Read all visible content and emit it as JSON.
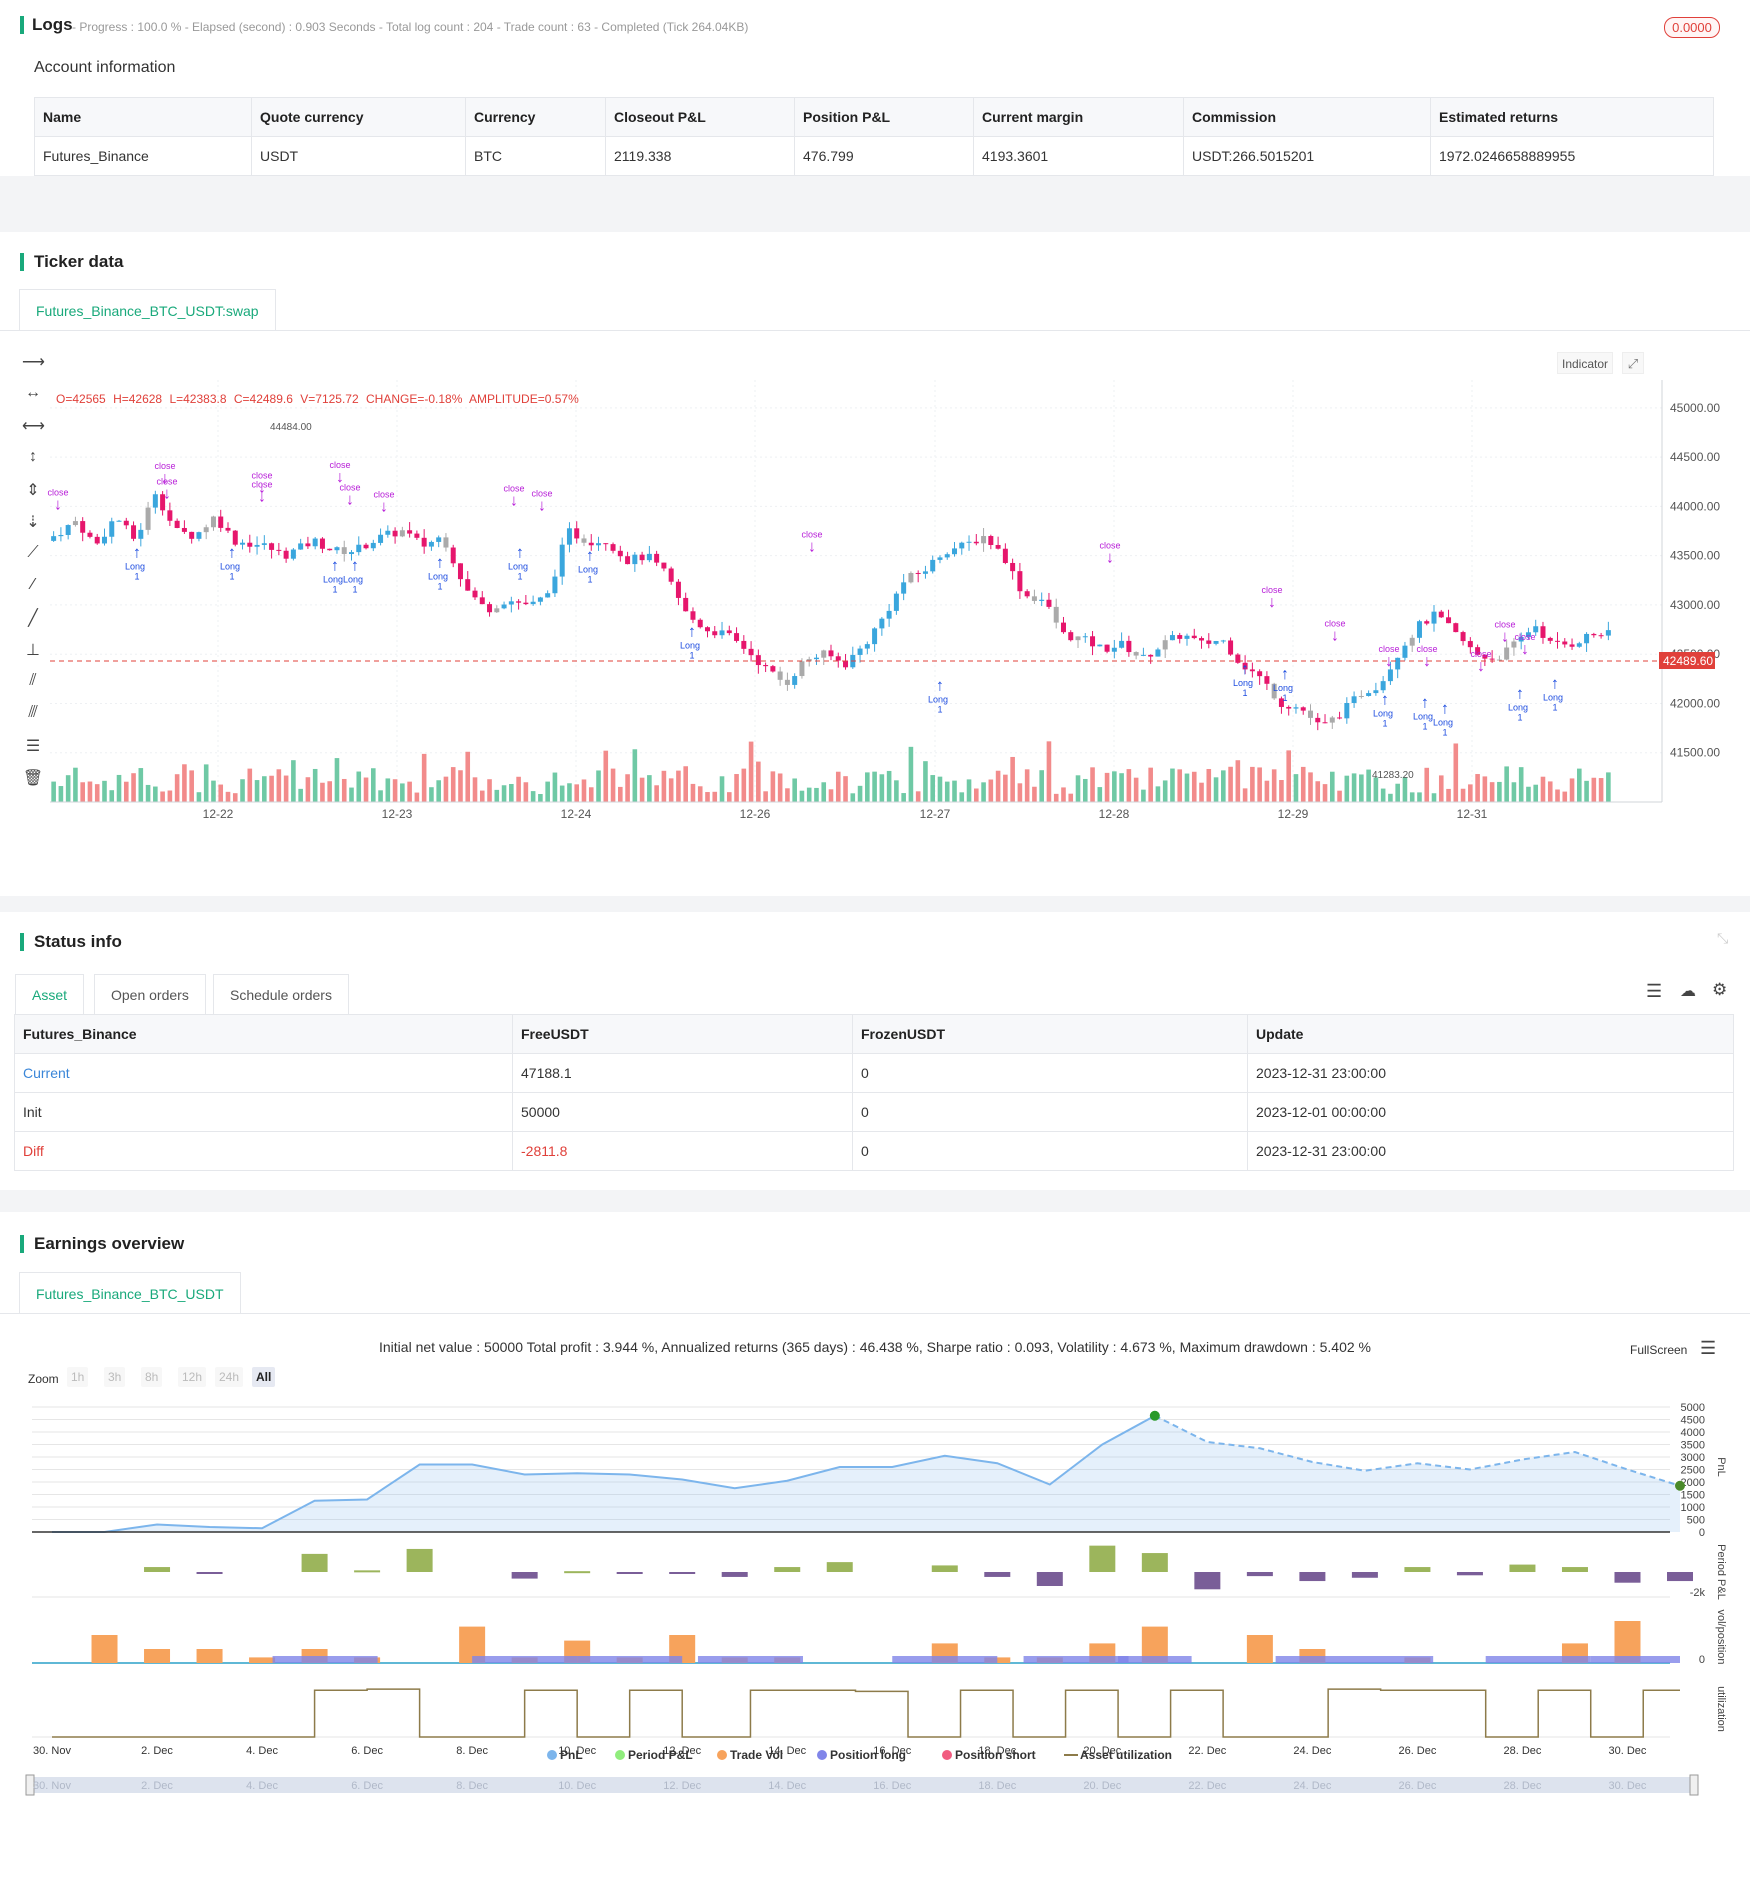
{
  "logs": {
    "title": "Logs",
    "status": "- Progress : 100.0 % - Elapsed (second) : 0.903 Seconds - Total log count : 204 - Trade count : 63 - Completed (Tick 264.04KB)",
    "badge": "0.0000",
    "account_title": "Account information",
    "headers": [
      "Name",
      "Quote currency",
      "Currency",
      "Closeout P&L",
      "Position P&L",
      "Current margin",
      "Commission",
      "Estimated returns"
    ],
    "row": [
      "Futures_Binance",
      "USDT",
      "BTC",
      "2119.338",
      "476.799",
      "4193.3601",
      "USDT:266.5015201",
      "1972.0246658889955"
    ]
  },
  "ticker": {
    "title": "Ticker data",
    "tab": "Futures_Binance_BTC_USDT:swap",
    "ohlc_o": "O=42565",
    "ohlc_h": "H=42628",
    "ohlc_l": "L=42383.8",
    "ohlc_c": "C=42489.6",
    "ohlc_v": "V=7125.72",
    "ohlc_change": "CHANGE=-0.18%",
    "ohlc_amp": "AMPLITUDE=0.57%",
    "indicator_btn": "Indicator",
    "current_price": "42489.60",
    "high_label": "44484.00",
    "low_label": "41283.20",
    "y_ticks": [
      "45000.00",
      "44500.00",
      "44000.00",
      "43500.00",
      "43000.00",
      "42500.00",
      "42000.00",
      "41500.00"
    ],
    "x_ticks": [
      "12-22",
      "12-23",
      "12-24",
      "12-26",
      "12-27",
      "12-28",
      "12-29",
      "12-31"
    ],
    "colors": {
      "up": "#3aa6dd",
      "down": "#e6166c",
      "neutral": "#aaaaaa",
      "long": "#1e4de0",
      "close": "#b81fd8",
      "current": "#e0403a"
    }
  },
  "status": {
    "title": "Status info",
    "tabs": [
      "Asset",
      "Open orders",
      "Schedule orders"
    ],
    "headers": [
      "Futures_Binance",
      "FreeUSDT",
      "FrozenUSDT",
      "Update"
    ],
    "rows": [
      [
        "Current",
        "47188.1",
        "0",
        "2023-12-31 23:00:00"
      ],
      [
        "Init",
        "50000",
        "0",
        "2023-12-01 00:00:00"
      ],
      [
        "Diff",
        "-2811.8",
        "0",
        "2023-12-31 23:00:00"
      ]
    ]
  },
  "earnings": {
    "title": "Earnings overview",
    "tab": "Futures_Binance_BTC_USDT",
    "summary": "Initial net value : 50000 Total profit : 3.944 %, Annualized returns (365 days) : 46.438 %, Sharpe ratio : 0.093, Volatility : 4.673 %, Maximum drawdown : 5.402 %",
    "fullscreen": "FullScreen",
    "zoom_label": "Zoom",
    "zoom_buttons": [
      "1h",
      "3h",
      "8h",
      "12h",
      "24h",
      "All"
    ],
    "pnl_ticks": [
      "5000",
      "4500",
      "4000",
      "3500",
      "3000",
      "2500",
      "2000",
      "1500",
      "1000",
      "500",
      "0"
    ],
    "axis_titles": [
      "PnL",
      "Period P&L",
      "vol/position",
      "utilization"
    ],
    "period_tick": "-2k",
    "vol_tick": "0",
    "x_dates": [
      "30. Nov",
      "2. Dec",
      "4. Dec",
      "6. Dec",
      "8. Dec",
      "10. Dec",
      "12. Dec",
      "14. Dec",
      "16. Dec",
      "18. Dec",
      "20. Dec",
      "22. Dec",
      "24. Dec",
      "26. Dec",
      "28. Dec",
      "30. Dec"
    ],
    "legend": [
      "PnL",
      "Period P&L",
      "Trade Vol",
      "Position long",
      "Position short",
      "Asset utilization"
    ],
    "legend_colors": [
      "#7cb5ec",
      "#90ed7d",
      "#f7a35c",
      "#8085e9",
      "#f15c80",
      "#8d7b4a"
    ]
  },
  "chart_data": [
    {
      "type": "line",
      "title": "PnL",
      "x": [
        "30. Nov",
        "1. Dec",
        "2. Dec",
        "3. Dec",
        "4. Dec",
        "5. Dec",
        "6. Dec",
        "7. Dec",
        "8. Dec",
        "9. Dec",
        "10. Dec",
        "11. Dec",
        "12. Dec",
        "13. Dec",
        "14. Dec",
        "15. Dec",
        "16. Dec",
        "17. Dec",
        "18. Dec",
        "19. Dec",
        "20. Dec",
        "21. Dec",
        "22. Dec",
        "23. Dec",
        "24. Dec",
        "25. Dec",
        "26. Dec",
        "27. Dec",
        "28. Dec",
        "29. Dec",
        "30. Dec",
        "31. Dec"
      ],
      "series": [
        {
          "name": "PnL",
          "values": [
            0,
            0,
            300,
            200,
            150,
            1250,
            1300,
            2700,
            2700,
            2300,
            2350,
            2300,
            2100,
            1750,
            2050,
            2600,
            2600,
            3050,
            2750,
            1900,
            3500,
            4650,
            3600,
            3350,
            2800,
            2450,
            2750,
            2500,
            2900,
            3200,
            2500,
            1850
          ]
        }
      ],
      "ylim": [
        0,
        5000
      ]
    },
    {
      "type": "bar",
      "title": "Period P&L",
      "categories": [
        "2. Dec",
        "3. Dec",
        "5. Dec",
        "6. Dec",
        "7. Dec",
        "9. Dec",
        "10. Dec",
        "11. Dec",
        "12. Dec",
        "13. Dec",
        "14. Dec",
        "15. Dec",
        "17. Dec",
        "18. Dec",
        "19. Dec",
        "20. Dec",
        "21. Dec",
        "22. Dec",
        "23. Dec",
        "24. Dec",
        "25. Dec",
        "26. Dec",
        "27. Dec",
        "28. Dec",
        "29. Dec",
        "30. Dec",
        "31. Dec"
      ],
      "values": [
        300,
        -100,
        1100,
        100,
        1400,
        -400,
        50,
        -50,
        -100,
        -300,
        300,
        600,
        400,
        -300,
        -850,
        1600,
        1150,
        -1050,
        -250,
        -550,
        -350,
        300,
        -200,
        450,
        300,
        -650,
        -550
      ]
    },
    {
      "type": "bar",
      "title": "vol/position",
      "series": [
        {
          "name": "Trade Vol",
          "values": [
            1.0,
            0.5,
            0.5,
            0.2,
            0.5,
            0.2,
            1.3,
            0.2,
            0.8,
            0.2,
            1.0,
            0.2,
            0.2,
            0.7,
            0.2,
            0.2,
            0.7,
            1.3,
            1.0,
            0.5,
            0.2,
            0.7,
            1.5
          ]
        },
        {
          "name": "Position long",
          "values": [
            0.2,
            0.2,
            0.2,
            0.2,
            0.2,
            0.2,
            0.2,
            0.2,
            0.2,
            0.2,
            0.2
          ]
        }
      ]
    },
    {
      "type": "line",
      "title": "utilization",
      "series": [
        {
          "name": "Asset utilization",
          "values": [
            0,
            0,
            0,
            0,
            0,
            0.85,
            0.87,
            0,
            0.85,
            0,
            0.85,
            0,
            0.85,
            0.83,
            0,
            0.85,
            0,
            0.85,
            0,
            0.85,
            0,
            0.87,
            0.85,
            0.85,
            0,
            0.85,
            0,
            0.85,
            0.85
          ]
        }
      ]
    }
  ]
}
